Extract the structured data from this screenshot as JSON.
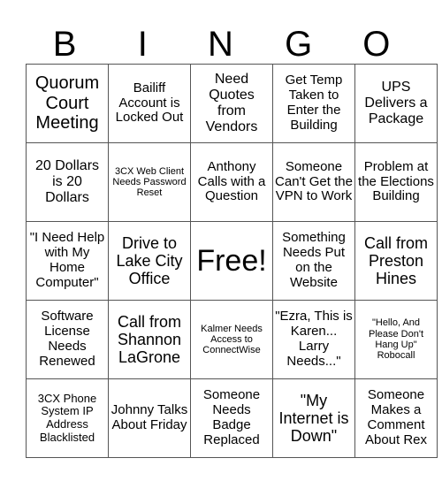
{
  "header": {
    "letters": [
      "B",
      "I",
      "N",
      "G",
      "O"
    ]
  },
  "rows": [
    [
      "Quorum Court Meeting",
      "Bailiff Account is Locked Out",
      "Need Quotes from Vendors",
      "Get Temp Taken to Enter the Building",
      "UPS Delivers a Package"
    ],
    [
      "20 Dollars is 20 Dollars",
      "3CX Web Client Needs Password Reset",
      "Anthony Calls with a Question",
      "Someone Can't Get the VPN to Work",
      "Problem at the Elections Building"
    ],
    [
      "\"I Need Help with My Home Computer\"",
      "Drive to Lake City Office",
      "Free!",
      "Something Needs Put on the Website",
      "Call from Preston Hines"
    ],
    [
      "Software License Needs Renewed",
      "Call from Shannon LaGrone",
      "Kalmer Needs Access to ConnectWise",
      "\"Ezra, This is Karen... Larry Needs...\"",
      "\"Hello, And Please Don't Hang Up\" Robocall"
    ],
    [
      "3CX Phone System IP Address Blacklisted",
      "Johnny Talks About Friday",
      "Someone Needs Badge Replaced",
      "\"My Internet is Down\"",
      "Someone Makes a Comment About Rex"
    ]
  ]
}
